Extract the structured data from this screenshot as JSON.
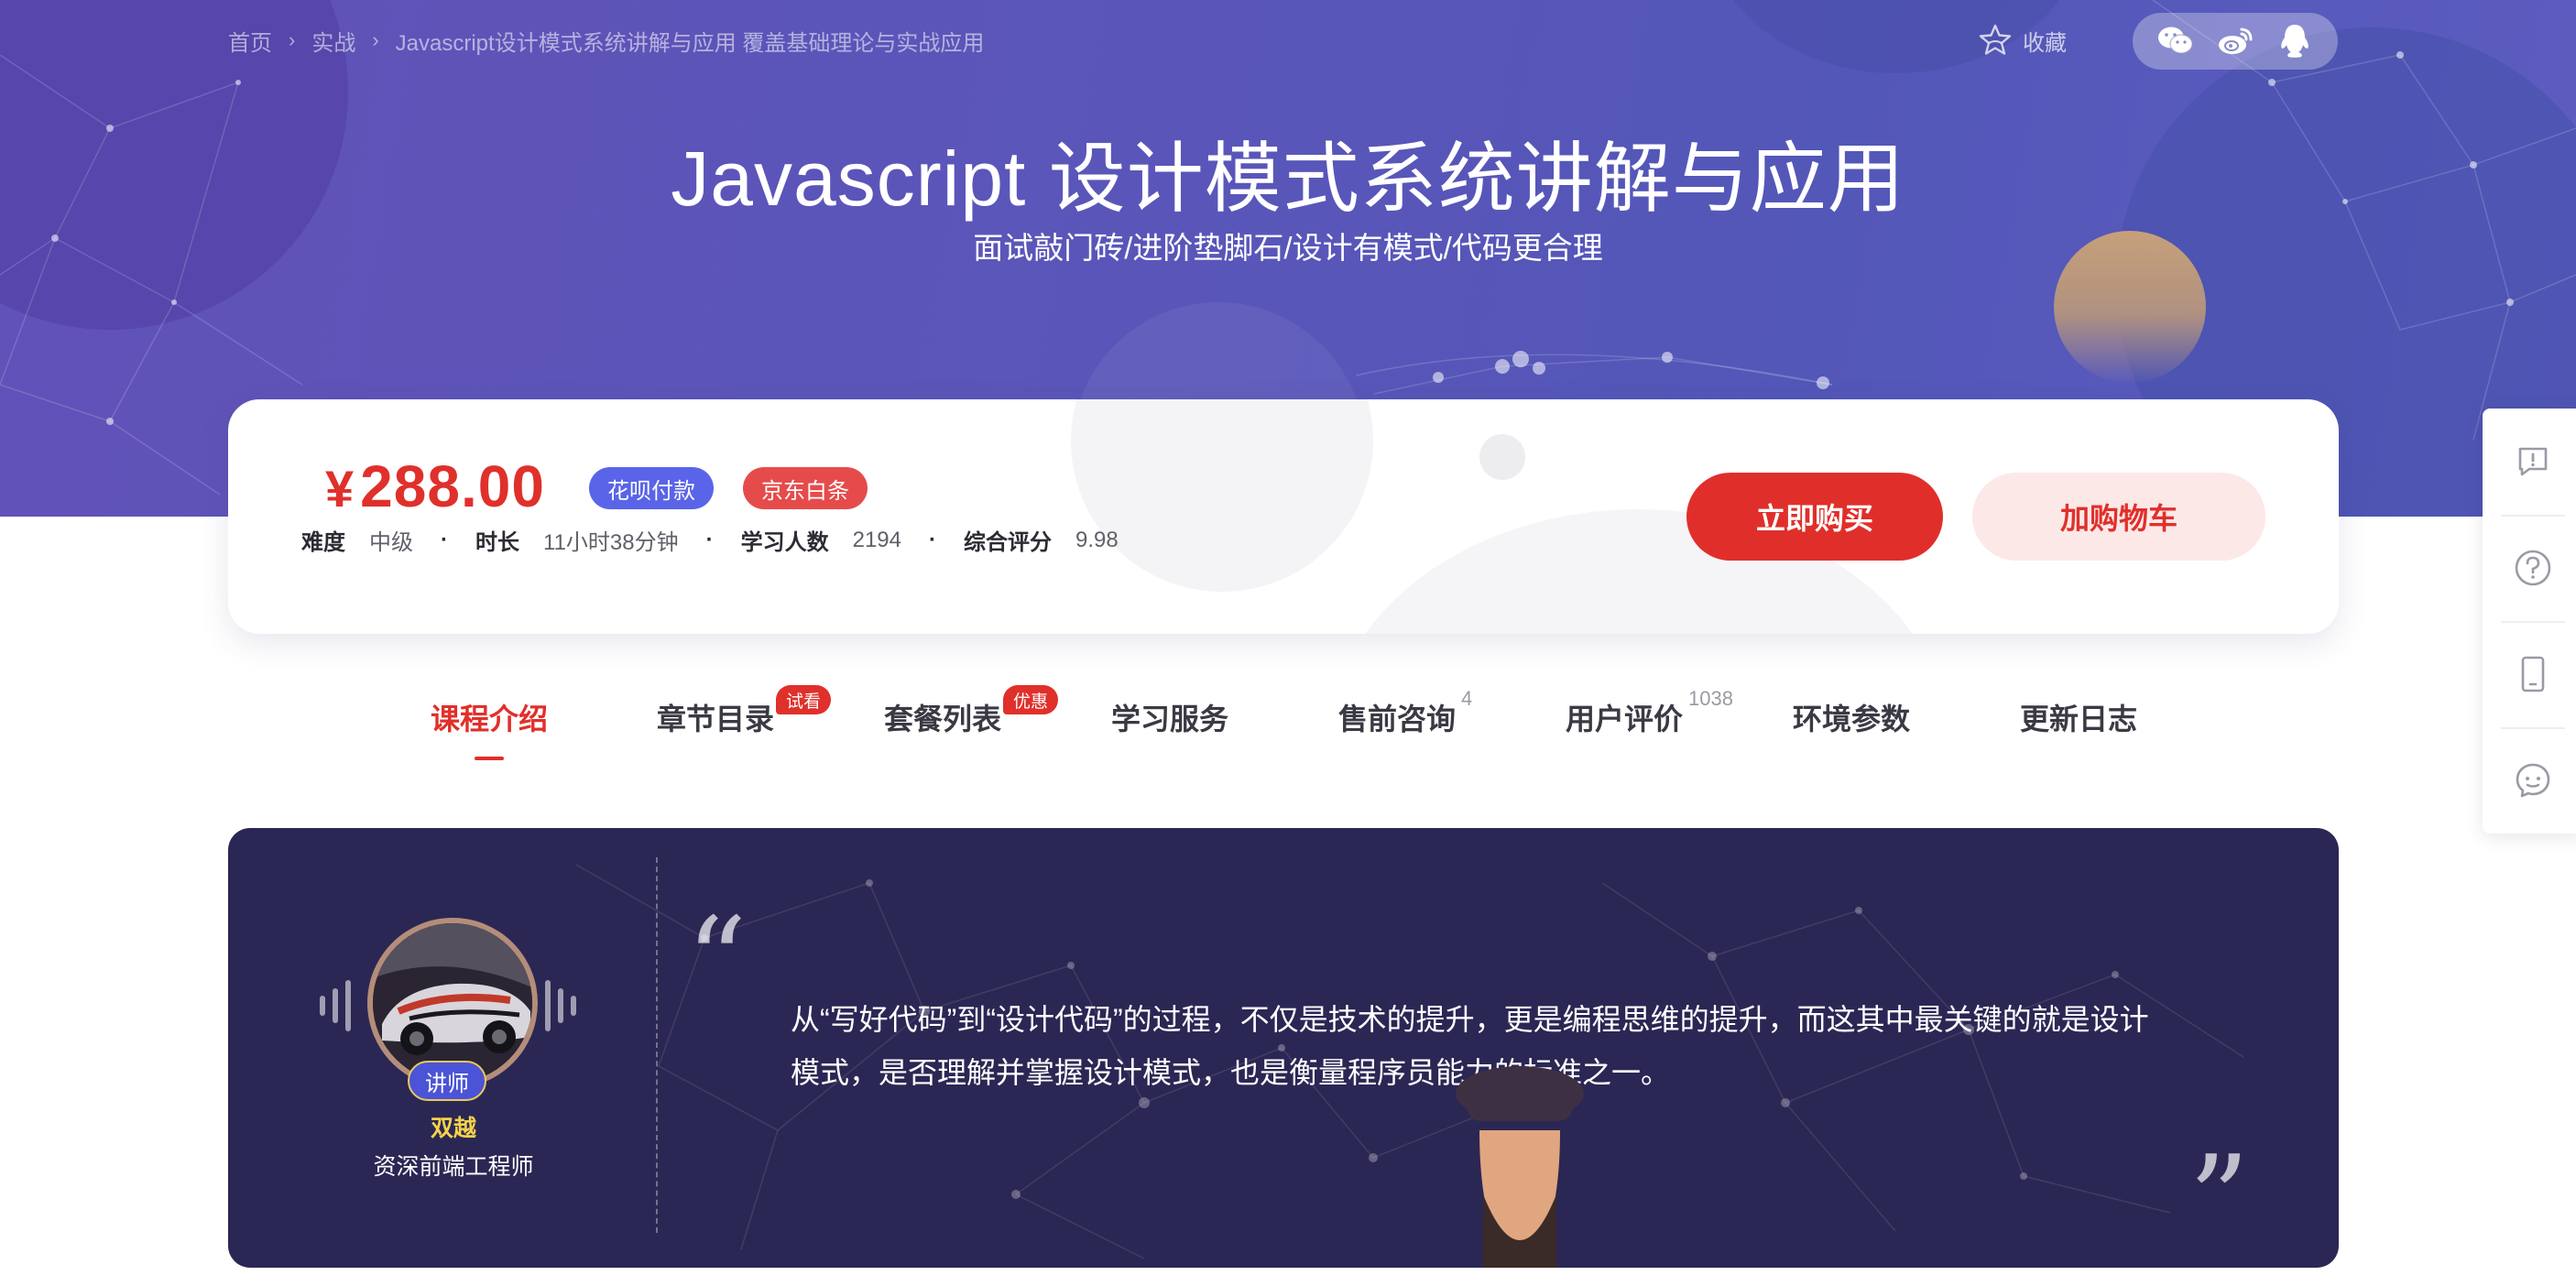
{
  "breadcrumb": {
    "items": [
      "首页",
      "实战",
      "Javascript设计模式系统讲解与应用 覆盖基础理论与实战应用"
    ],
    "separator": "›"
  },
  "favorite": {
    "label": "收藏",
    "icon": "star-outline-icon"
  },
  "share": {
    "icons": [
      "wechat-icon",
      "weibo-icon",
      "qq-icon"
    ]
  },
  "course": {
    "title": "Javascript 设计模式系统讲解与应用",
    "subtitle": "面试敲门砖/进阶垫脚石/设计有模式/代码更合理"
  },
  "price_card": {
    "currency": "¥",
    "price": "288.00",
    "payment_tags": [
      "花呗付款",
      "京东白条"
    ],
    "meta": [
      {
        "key": "难度",
        "value": "中级"
      },
      {
        "key": "时长",
        "value": "11小时38分钟"
      },
      {
        "key": "学习人数",
        "value": "2194"
      },
      {
        "key": "综合评分",
        "value": "9.98"
      }
    ],
    "buy_label": "立即购买",
    "cart_label": "加购物车"
  },
  "tabs": [
    {
      "label": "课程介绍",
      "active": true
    },
    {
      "label": "章节目录",
      "badge": "试看"
    },
    {
      "label": "套餐列表",
      "badge": "优惠"
    },
    {
      "label": "学习服务"
    },
    {
      "label": "售前咨询",
      "count": "4"
    },
    {
      "label": "用户评价",
      "count": "1038"
    },
    {
      "label": "环境参数"
    },
    {
      "label": "更新日志"
    }
  ],
  "side_toolbar": {
    "icons": [
      "feedback-icon",
      "help-icon",
      "mobile-icon",
      "chat-icon"
    ]
  },
  "teacher": {
    "role": "讲师",
    "name": "双越",
    "title": "资深前端工程师",
    "quote": "从“写好代码”到“设计代码”的过程，不仅是技术的提升，更是编程思维的提升，而这其中最关键的就是设计模式，是否理解并掌握设计模式，也是衡量程序员能力的标准之一。",
    "quote_open": "“",
    "quote_close": "”"
  },
  "colors": {
    "accent_red": "#e0302b",
    "hero_purple": "#5a56b9",
    "teacher_bg": "#2b2754",
    "huabei_blue": "#5a64e8",
    "name_yellow": "#f5d24a"
  }
}
